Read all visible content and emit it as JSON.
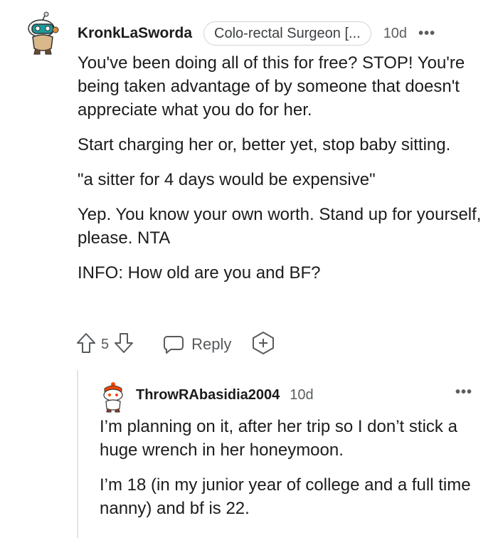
{
  "comment": {
    "username": "KronkLaSworda",
    "flair": "Colo-rectal Surgeon [...",
    "time": "10d",
    "more": "•••",
    "paragraphs": [
      "You've been doing all of this for free? STOP! You're being taken advantage of by someone that doesn't appreciate what you do for her.",
      "Start charging her or, better yet, stop baby sitting.",
      "\"a sitter for 4 days would be expensive\"",
      "Yep. You know your own worth. Stand up for yourself, please. NTA",
      "INFO: How old are you and BF?"
    ],
    "votes": "5",
    "reply_label": "Reply",
    "icons": {
      "upvote": "upvote-arrow-icon",
      "downvote": "downvote-arrow-icon",
      "reply": "chat-bubble-icon",
      "award": "award-plus-icon"
    }
  },
  "reply": {
    "username": "ThrowRAbasidia2004",
    "time": "10d",
    "more": "•••",
    "paragraphs": [
      "I’m planning on it, after her trip so I don’t stick a huge wrench in her honeymoon.",
      "I’m 18 (in my junior year of college and a full time nanny) and bf is 22."
    ]
  }
}
